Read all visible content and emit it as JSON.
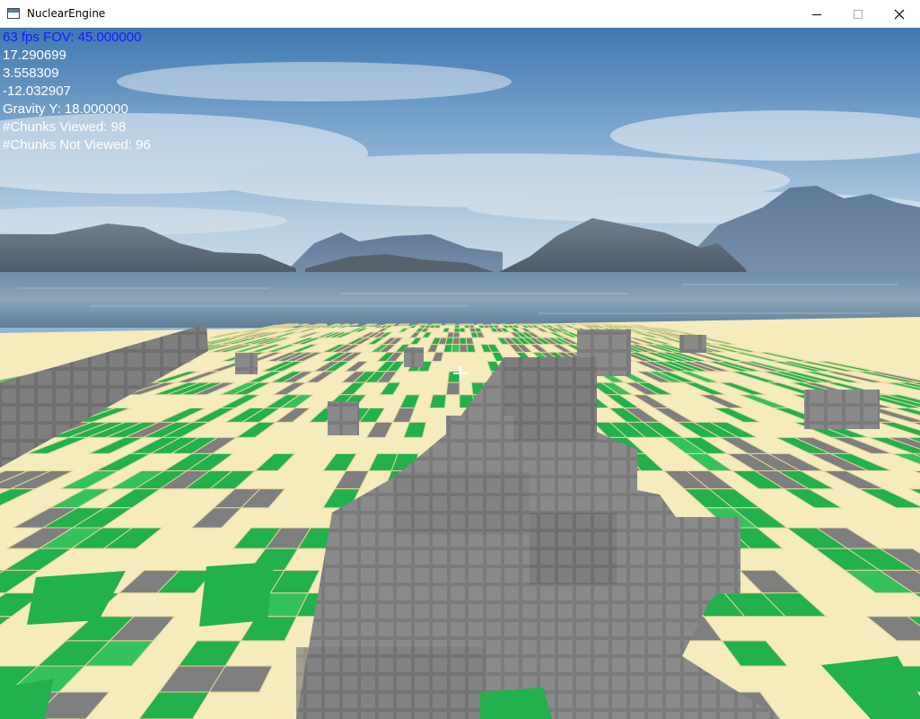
{
  "window": {
    "title": "NuclearEngine",
    "icon": "app-window-icon",
    "controls": [
      "minimize-icon",
      "maximize-icon",
      "close-icon"
    ]
  },
  "hud": {
    "fps_fov": "63 fps FOV: 45.000000",
    "pos_x": "17.290699",
    "pos_y": "3.558309",
    "pos_z": "-12.032907",
    "gravity": "Gravity Y: 18.000000",
    "chunks_viewed": "#Chunks Viewed: 98",
    "chunks_not_viewed": "#Chunks Not Viewed: 96"
  },
  "colors": {
    "sand": "#f5ebbd",
    "grass": "#22b14c",
    "stone": "#7f7f7f",
    "hud_fps_text": "#1a1aff",
    "hud_text": "#ffffff"
  }
}
